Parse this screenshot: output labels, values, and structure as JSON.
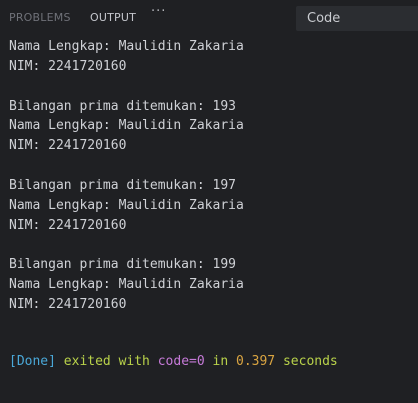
{
  "tabs": {
    "problems": "PROBLEMS",
    "output": "OUTPUT",
    "more": "···"
  },
  "channel_select": {
    "value": "Code"
  },
  "output_lines": [
    "Nama Lengkap: Maulidin Zakaria",
    "NIM: 2241720160",
    "",
    "Bilangan prima ditemukan: 193",
    "Nama Lengkap: Maulidin Zakaria",
    "NIM: 2241720160",
    "",
    "Bilangan prima ditemukan: 197",
    "Nama Lengkap: Maulidin Zakaria",
    "NIM: 2241720160",
    "",
    "Bilangan prima ditemukan: 199",
    "Nama Lengkap: Maulidin Zakaria",
    "NIM: 2241720160"
  ],
  "done": {
    "tag": "[Done]",
    "text1": " exited with ",
    "code": "code=0",
    "text2": " in ",
    "duration": "0.397",
    "text3": " seconds"
  },
  "colors": {
    "background": "#1f2023",
    "done_tag": "#4aa8d8",
    "done_text": "#b9d24a",
    "done_code": "#c67ad8",
    "done_duration": "#d9a441"
  }
}
